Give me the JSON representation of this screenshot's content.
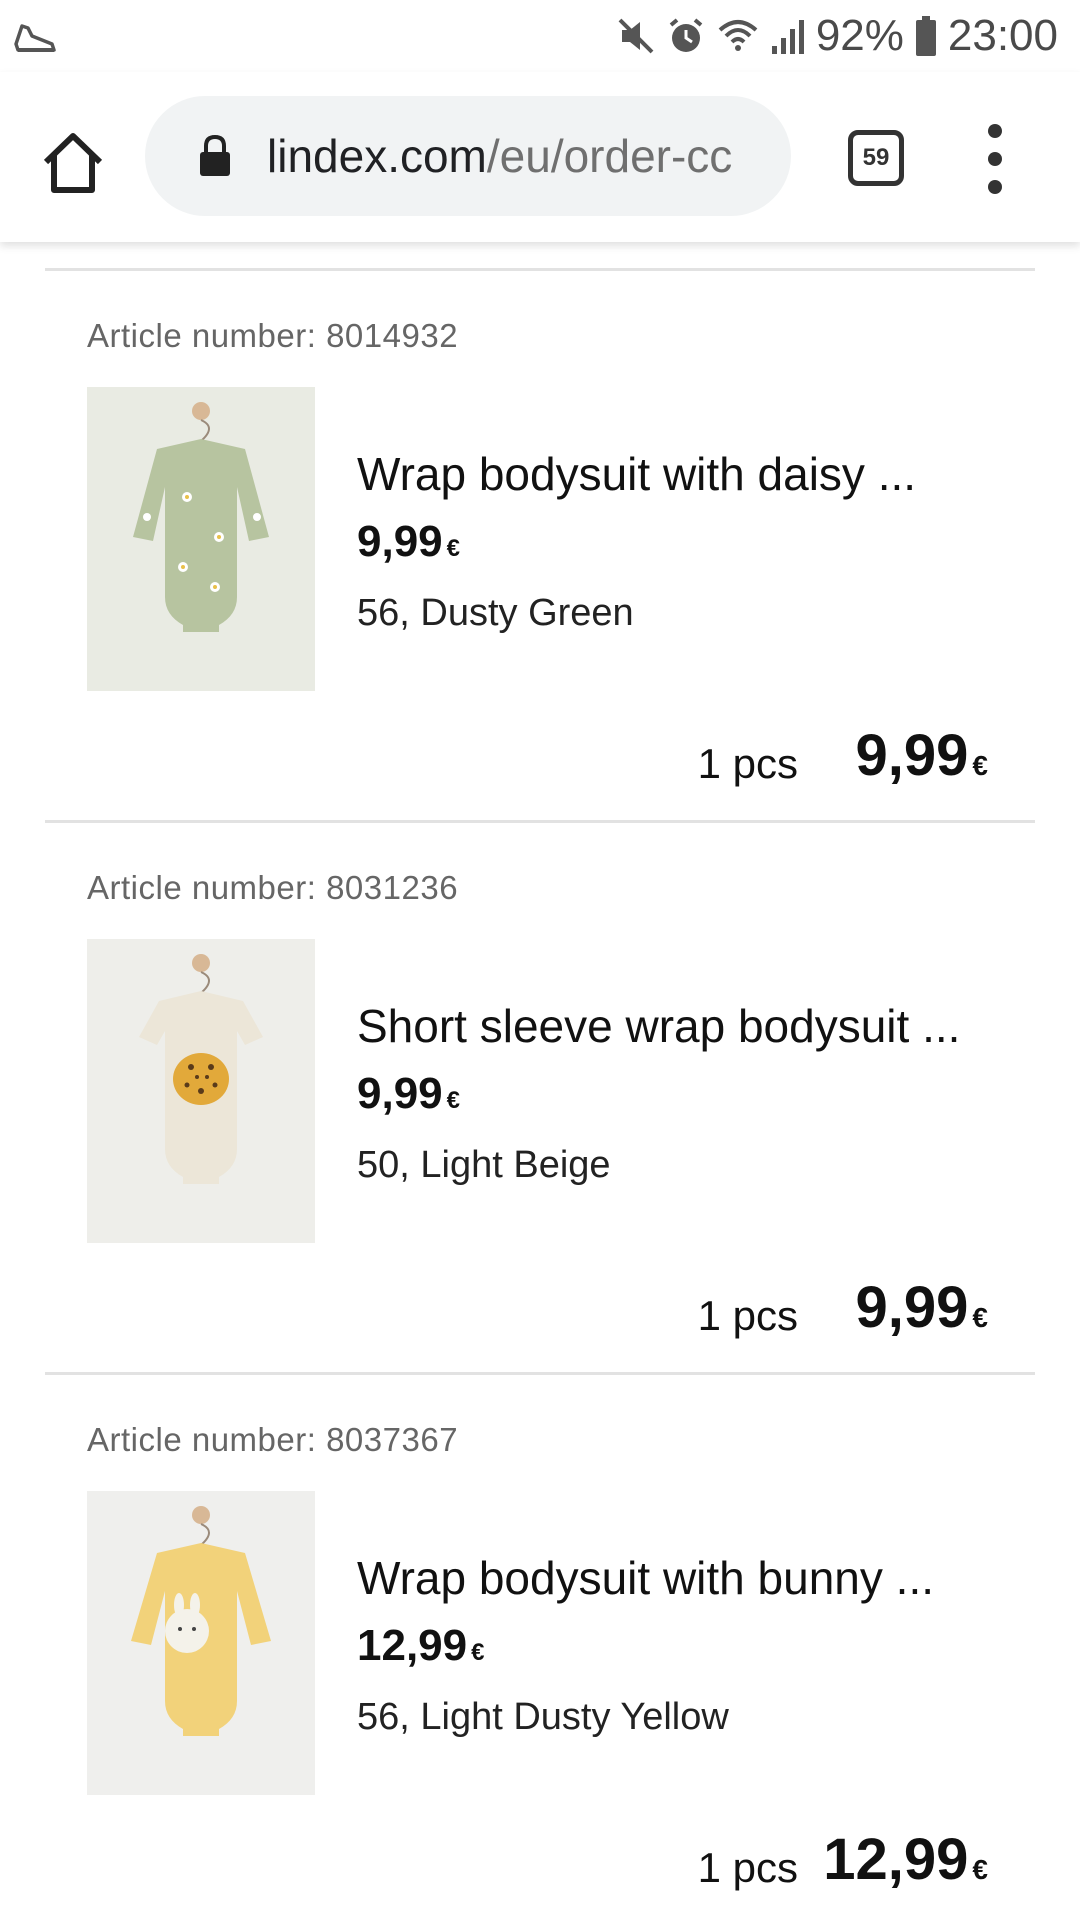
{
  "status_bar": {
    "battery": "92%",
    "time": "23:00"
  },
  "browser": {
    "url_domain": "lindex.com",
    "url_path": "/eu/order-cc",
    "tab_count": "59"
  },
  "items": [
    {
      "article_label": "Article number: 8014932",
      "name": "Wrap bodysuit with daisy ...",
      "price": "9,99",
      "currency": "€",
      "variant": "56, Dusty Green",
      "quantity": "1 pcs",
      "total": "9,99",
      "swatch": "#b7c4a0"
    },
    {
      "article_label": "Article number: 8031236",
      "name": "Short sleeve wrap bodysuit ...",
      "price": "9,99",
      "currency": "€",
      "variant": "50, Light Beige",
      "quantity": "1 pcs",
      "total": "9,99",
      "swatch": "#ece6d8"
    },
    {
      "article_label": "Article number: 8037367",
      "name": "Wrap bodysuit with bunny ...",
      "price": "12,99",
      "currency": "€",
      "variant": "56, Light Dusty Yellow",
      "quantity": "1 pcs",
      "total": "12,99",
      "swatch": "#f2d27a"
    }
  ]
}
